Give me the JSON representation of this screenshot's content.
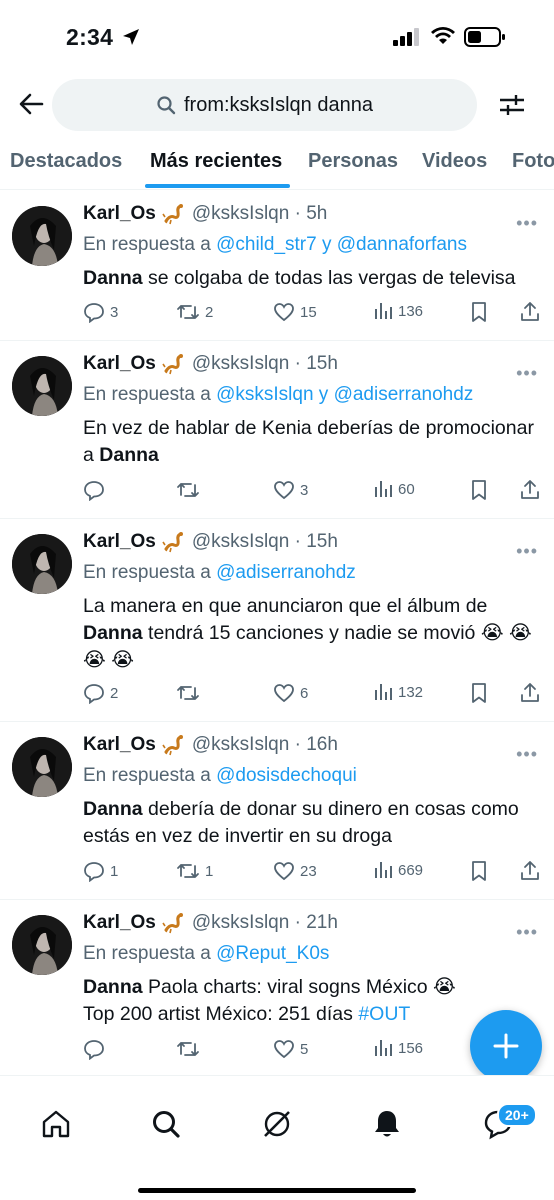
{
  "status_bar": {
    "time": "2:34"
  },
  "search": {
    "query": "from:ksksIslqn danna"
  },
  "tabs": [
    {
      "label": "Destacados"
    },
    {
      "label": "Más recientes"
    },
    {
      "label": "Personas"
    },
    {
      "label": "Videos"
    },
    {
      "label": "Foto"
    }
  ],
  "tweets": [
    {
      "name": "Karl_Os",
      "handle": "@ksksIslqn",
      "time": "5h",
      "reply_prefix": "En respuesta a",
      "reply_to_1": "@child_str7",
      "reply_joiner": "y",
      "reply_to_2": "@dannaforfans",
      "text_bold": "Danna",
      "text_rest": " se colgaba de todas las vergas de televisa",
      "replies": "3",
      "retweets": "2",
      "likes": "15",
      "views": "136"
    },
    {
      "name": "Karl_Os",
      "handle": "@ksksIslqn",
      "time": "15h",
      "reply_prefix": "En respuesta a",
      "reply_to_1": "@ksksIslqn",
      "reply_joiner": "y",
      "reply_to_2": "@adiserranohdz",
      "text_pre": "En vez de hablar de Kenia deberías de promocionar a ",
      "text_bold": "Danna",
      "replies": "",
      "retweets": "",
      "likes": "3",
      "views": "60"
    },
    {
      "name": "Karl_Os",
      "handle": "@ksksIslqn",
      "time": "15h",
      "reply_prefix": "En respuesta a",
      "reply_to_1": "@adiserranohdz",
      "text_pre": "La manera en que anunciaron que el álbum de ",
      "text_bold": "Danna",
      "text_rest": " tendrá 15 canciones y nadie se movió 😭 😭 😭 😭",
      "replies": "2",
      "retweets": "",
      "likes": "6",
      "views": "132"
    },
    {
      "name": "Karl_Os",
      "handle": "@ksksIslqn",
      "time": "16h",
      "reply_prefix": "En respuesta a",
      "reply_to_1": "@dosisdechoqui",
      "text_bold": "Danna",
      "text_rest": " debería de donar su dinero en cosas como estás en vez de invertir en su droga",
      "replies": "1",
      "retweets": "1",
      "likes": "23",
      "views": "669"
    },
    {
      "name": "Karl_Os",
      "handle": "@ksksIslqn",
      "time": "21h",
      "reply_prefix": "En respuesta a",
      "reply_to_1": "@Reput_K0s",
      "text_bold": "Danna",
      "text_rest": " Paola charts: viral sogns México 😭",
      "text_line2": "Top 200 artist México: 251 días ",
      "text_hashtag": "#OUT",
      "replies": "",
      "retweets": "",
      "likes": "5",
      "views": "156"
    }
  ],
  "bottom_nav": {
    "badge": "20+"
  },
  "colors": {
    "accent": "#1d9bf0",
    "text": "#0f1419",
    "muted": "#536471"
  }
}
